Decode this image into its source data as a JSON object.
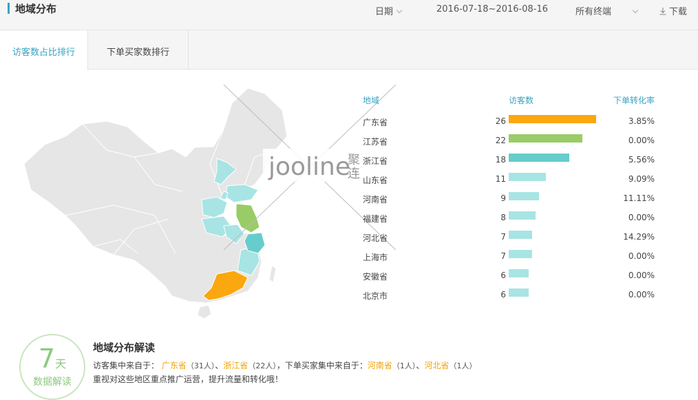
{
  "header": {
    "title": "地域分布",
    "date_label": "日期",
    "date_range": "2016-07-18~2016-08-16",
    "terminal_label": "所有终端",
    "download_label": "下载"
  },
  "tabs": [
    {
      "label": "访客数占比排行",
      "active": true
    },
    {
      "label": "下单买家数排行",
      "active": false
    }
  ],
  "table": {
    "col_region": "地域",
    "col_visitors": "访客数",
    "col_conversion": "下单转化率",
    "rows": [
      {
        "province": "广东省",
        "visitors": "26",
        "rate": "3.85%",
        "color": "#fba70f",
        "ratio": 1.0
      },
      {
        "province": "江苏省",
        "visitors": "22",
        "rate": "0.00%",
        "color": "#99cc66",
        "ratio": 0.846
      },
      {
        "province": "浙江省",
        "visitors": "18",
        "rate": "5.56%",
        "color": "#66cccc",
        "ratio": 0.692
      },
      {
        "province": "山东省",
        "visitors": "11",
        "rate": "9.09%",
        "color": "#a8e4e4",
        "ratio": 0.423
      },
      {
        "province": "河南省",
        "visitors": "9",
        "rate": "11.11%",
        "color": "#a8e4e4",
        "ratio": 0.346
      },
      {
        "province": "福建省",
        "visitors": "8",
        "rate": "0.00%",
        "color": "#a8e4e4",
        "ratio": 0.308
      },
      {
        "province": "河北省",
        "visitors": "7",
        "rate": "14.29%",
        "color": "#a8e4e4",
        "ratio": 0.269
      },
      {
        "province": "上海市",
        "visitors": "7",
        "rate": "0.00%",
        "color": "#a8e4e4",
        "ratio": 0.269
      },
      {
        "province": "安徽省",
        "visitors": "6",
        "rate": "0.00%",
        "color": "#a8e4e4",
        "ratio": 0.231
      },
      {
        "province": "北京市",
        "visitors": "6",
        "rate": "0.00%",
        "color": "#a8e4e4",
        "ratio": 0.231
      }
    ]
  },
  "watermark": {
    "brand": "jooline",
    "cn": "聚连"
  },
  "badge": {
    "number": "7",
    "unit": "天",
    "text": "数据解读"
  },
  "insight": {
    "title": "地域分布解读",
    "line1_prefix": "访客集中来自于：",
    "v1_name": "广东省",
    "v1_count": "（31人）",
    "sep1": "、",
    "v2_name": "浙江省",
    "v2_count": "（22人）",
    "line1_mid": "，下单买家集中来自于：",
    "b1_name": "河南省",
    "b1_count": "（1人）",
    "sep2": "、",
    "b2_name": "河北省",
    "b2_count": "（1人）",
    "line2": "重视对这些地区重点推广运营，提升流量和转化哦！"
  },
  "colors": {
    "accent": "#38a3c3",
    "highlight": "#f0a30a",
    "badge": "#8cc97d"
  }
}
